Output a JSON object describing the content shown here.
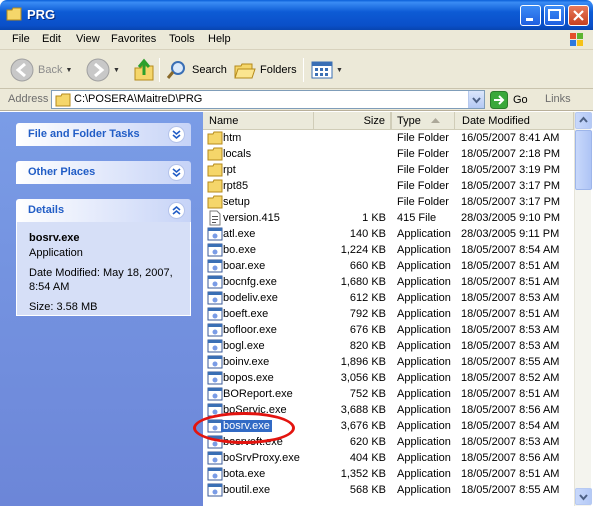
{
  "window": {
    "title": "PRG"
  },
  "menu": [
    "File",
    "Edit",
    "View",
    "Favorites",
    "Tools",
    "Help"
  ],
  "toolbar": {
    "back": "Back",
    "search": "Search",
    "folders": "Folders"
  },
  "address": {
    "label": "Address",
    "path": "C:\\POSERA\\MaitreD\\PRG",
    "go": "Go",
    "links": "Links"
  },
  "tasks": {
    "file_folder": "File and Folder Tasks",
    "other_places": "Other Places",
    "details": "Details"
  },
  "details": {
    "name": "bosrv.exe",
    "type": "Application",
    "modified": "Date Modified: May 18, 2007, 8:54 AM",
    "size": "Size: 3.58 MB"
  },
  "columns": {
    "name": "Name",
    "size": "Size",
    "type": "Type",
    "date": "Date Modified"
  },
  "files": [
    {
      "name": "htm",
      "size": "",
      "type": "File Folder",
      "date": "16/05/2007 8:41 AM",
      "icon": "folder"
    },
    {
      "name": "locals",
      "size": "",
      "type": "File Folder",
      "date": "18/05/2007 2:18 PM",
      "icon": "folder"
    },
    {
      "name": "rpt",
      "size": "",
      "type": "File Folder",
      "date": "18/05/2007 3:19 PM",
      "icon": "folder"
    },
    {
      "name": "rpt85",
      "size": "",
      "type": "File Folder",
      "date": "18/05/2007 3:17 PM",
      "icon": "folder"
    },
    {
      "name": "setup",
      "size": "",
      "type": "File Folder",
      "date": "18/05/2007 3:17 PM",
      "icon": "folder"
    },
    {
      "name": "version.415",
      "size": "1 KB",
      "type": "415 File",
      "date": "28/03/2005 9:10 PM",
      "icon": "file"
    },
    {
      "name": "atl.exe",
      "size": "140 KB",
      "type": "Application",
      "date": "28/03/2005 9:11 PM",
      "icon": "app"
    },
    {
      "name": "bo.exe",
      "size": "1,224 KB",
      "type": "Application",
      "date": "18/05/2007 8:54 AM",
      "icon": "app"
    },
    {
      "name": "boar.exe",
      "size": "660 KB",
      "type": "Application",
      "date": "18/05/2007 8:51 AM",
      "icon": "app"
    },
    {
      "name": "bocnfg.exe",
      "size": "1,680 KB",
      "type": "Application",
      "date": "18/05/2007 8:51 AM",
      "icon": "app"
    },
    {
      "name": "bodeliv.exe",
      "size": "612 KB",
      "type": "Application",
      "date": "18/05/2007 8:53 AM",
      "icon": "app"
    },
    {
      "name": "boeft.exe",
      "size": "792 KB",
      "type": "Application",
      "date": "18/05/2007 8:51 AM",
      "icon": "app"
    },
    {
      "name": "bofloor.exe",
      "size": "676 KB",
      "type": "Application",
      "date": "18/05/2007 8:53 AM",
      "icon": "app"
    },
    {
      "name": "bogl.exe",
      "size": "820 KB",
      "type": "Application",
      "date": "18/05/2007 8:53 AM",
      "icon": "app"
    },
    {
      "name": "boinv.exe",
      "size": "1,896 KB",
      "type": "Application",
      "date": "18/05/2007 8:55 AM",
      "icon": "app"
    },
    {
      "name": "bopos.exe",
      "size": "3,056 KB",
      "type": "Application",
      "date": "18/05/2007 8:52 AM",
      "icon": "app"
    },
    {
      "name": "BOReport.exe",
      "size": "752 KB",
      "type": "Application",
      "date": "18/05/2007 8:51 AM",
      "icon": "app"
    },
    {
      "name": "boServic.exe",
      "size": "3,688 KB",
      "type": "Application",
      "date": "18/05/2007 8:56 AM",
      "icon": "app"
    },
    {
      "name": "bosrv.exe",
      "size": "3,676 KB",
      "type": "Application",
      "date": "18/05/2007 8:54 AM",
      "icon": "app",
      "selected": true
    },
    {
      "name": "bosrveft.exe",
      "size": "620 KB",
      "type": "Application",
      "date": "18/05/2007 8:53 AM",
      "icon": "app"
    },
    {
      "name": "boSrvProxy.exe",
      "size": "404 KB",
      "type": "Application",
      "date": "18/05/2007 8:56 AM",
      "icon": "app"
    },
    {
      "name": "bota.exe",
      "size": "1,352 KB",
      "type": "Application",
      "date": "18/05/2007 8:51 AM",
      "icon": "app"
    },
    {
      "name": "boutil.exe",
      "size": "568 KB",
      "type": "Application",
      "date": "18/05/2007 8:55 AM",
      "icon": "app"
    }
  ]
}
